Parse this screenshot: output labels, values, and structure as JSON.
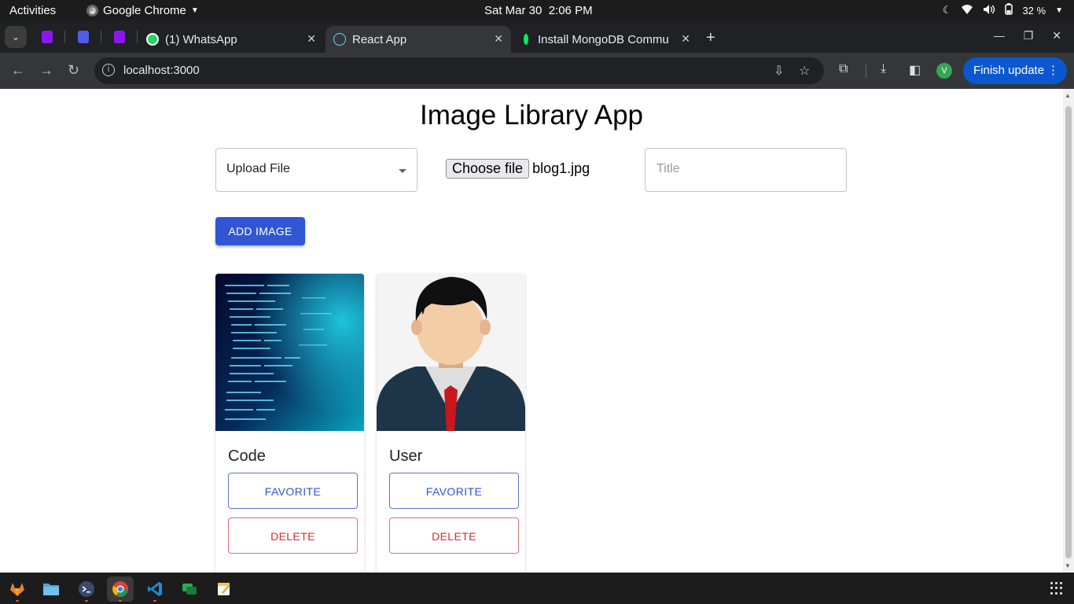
{
  "system_bar": {
    "activities": "Activities",
    "app_name": "Google Chrome",
    "clock": "Sat Mar 30  2:06 PM",
    "battery": "32 %"
  },
  "tabs": [
    {
      "label": "(1) WhatsApp",
      "active": false
    },
    {
      "label": "React App",
      "active": true
    },
    {
      "label": "Install MongoDB Commu",
      "active": false
    }
  ],
  "toolbar": {
    "url": "localhost:3000",
    "avatar_letter": "V",
    "finish_update": "Finish update"
  },
  "app": {
    "title": "Image Library App",
    "upload_select": {
      "value": "Upload File"
    },
    "file_input": {
      "button_label": "Choose file",
      "file_name": "blog1.jpg"
    },
    "title_input": {
      "placeholder": "Title"
    },
    "add_button": "ADD IMAGE",
    "cards": [
      {
        "title": "Code",
        "favorite_label": "FAVORITE",
        "delete_label": "DELETE",
        "image": "code-screen-image"
      },
      {
        "title": "User",
        "favorite_label": "FAVORITE",
        "delete_label": "DELETE",
        "image": "user-avatar-image"
      }
    ]
  },
  "taskbar": {
    "apps": [
      "gitlab-icon",
      "files-icon",
      "terminal-icon",
      "chrome-icon",
      "vscode-icon",
      "chat-icon",
      "text-editor-icon"
    ]
  },
  "colors": {
    "primary": "#3056d3",
    "danger": "#d32f2f",
    "finish_update": "#0b57d0"
  }
}
